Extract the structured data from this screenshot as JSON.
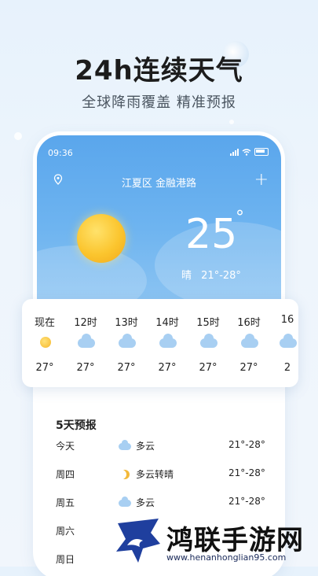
{
  "promo": {
    "headline": "24h连续天气",
    "subline": "全球降雨覆盖 精准预报"
  },
  "status_bar": {
    "time": "09:36"
  },
  "location": "江夏区 金融港路",
  "current": {
    "temp": "25",
    "deg": "°",
    "condition": "晴",
    "range": "21°-28°"
  },
  "hourly": [
    {
      "label": "现在",
      "icon": "sun-icon",
      "temp": "27°"
    },
    {
      "label": "12时",
      "icon": "cloud-icon",
      "temp": "27°"
    },
    {
      "label": "13时",
      "icon": "cloud-icon",
      "temp": "27°"
    },
    {
      "label": "14时",
      "icon": "cloud-icon",
      "temp": "27°"
    },
    {
      "label": "15时",
      "icon": "cloud-icon",
      "temp": "27°"
    },
    {
      "label": "16时",
      "icon": "cloud-icon",
      "temp": "27°"
    },
    {
      "label": "16",
      "icon": "cloud-icon",
      "temp": "2"
    }
  ],
  "forecast": {
    "title": "5天预报",
    "days": [
      {
        "day": "今天",
        "icon": "cloud-icon",
        "condition": "多云",
        "range": "21°-28°"
      },
      {
        "day": "周四",
        "icon": "moon-icon",
        "condition": "多云转晴",
        "range": "21°-28°"
      },
      {
        "day": "周五",
        "icon": "cloud-icon",
        "condition": "多云",
        "range": "21°-28°"
      },
      {
        "day": "周六",
        "icon": "",
        "condition": "",
        "range": ""
      },
      {
        "day": "周日",
        "icon": "",
        "condition": "",
        "range": ""
      }
    ]
  },
  "watermark": {
    "title": "鸿联手游网",
    "url": "www.henanhonglian95.com"
  },
  "colors": {
    "sky_top": "#5aa6ec",
    "sky_bottom": "#8cc4f2",
    "sun": "#fbc52e",
    "cloud": "#a8cff2"
  }
}
